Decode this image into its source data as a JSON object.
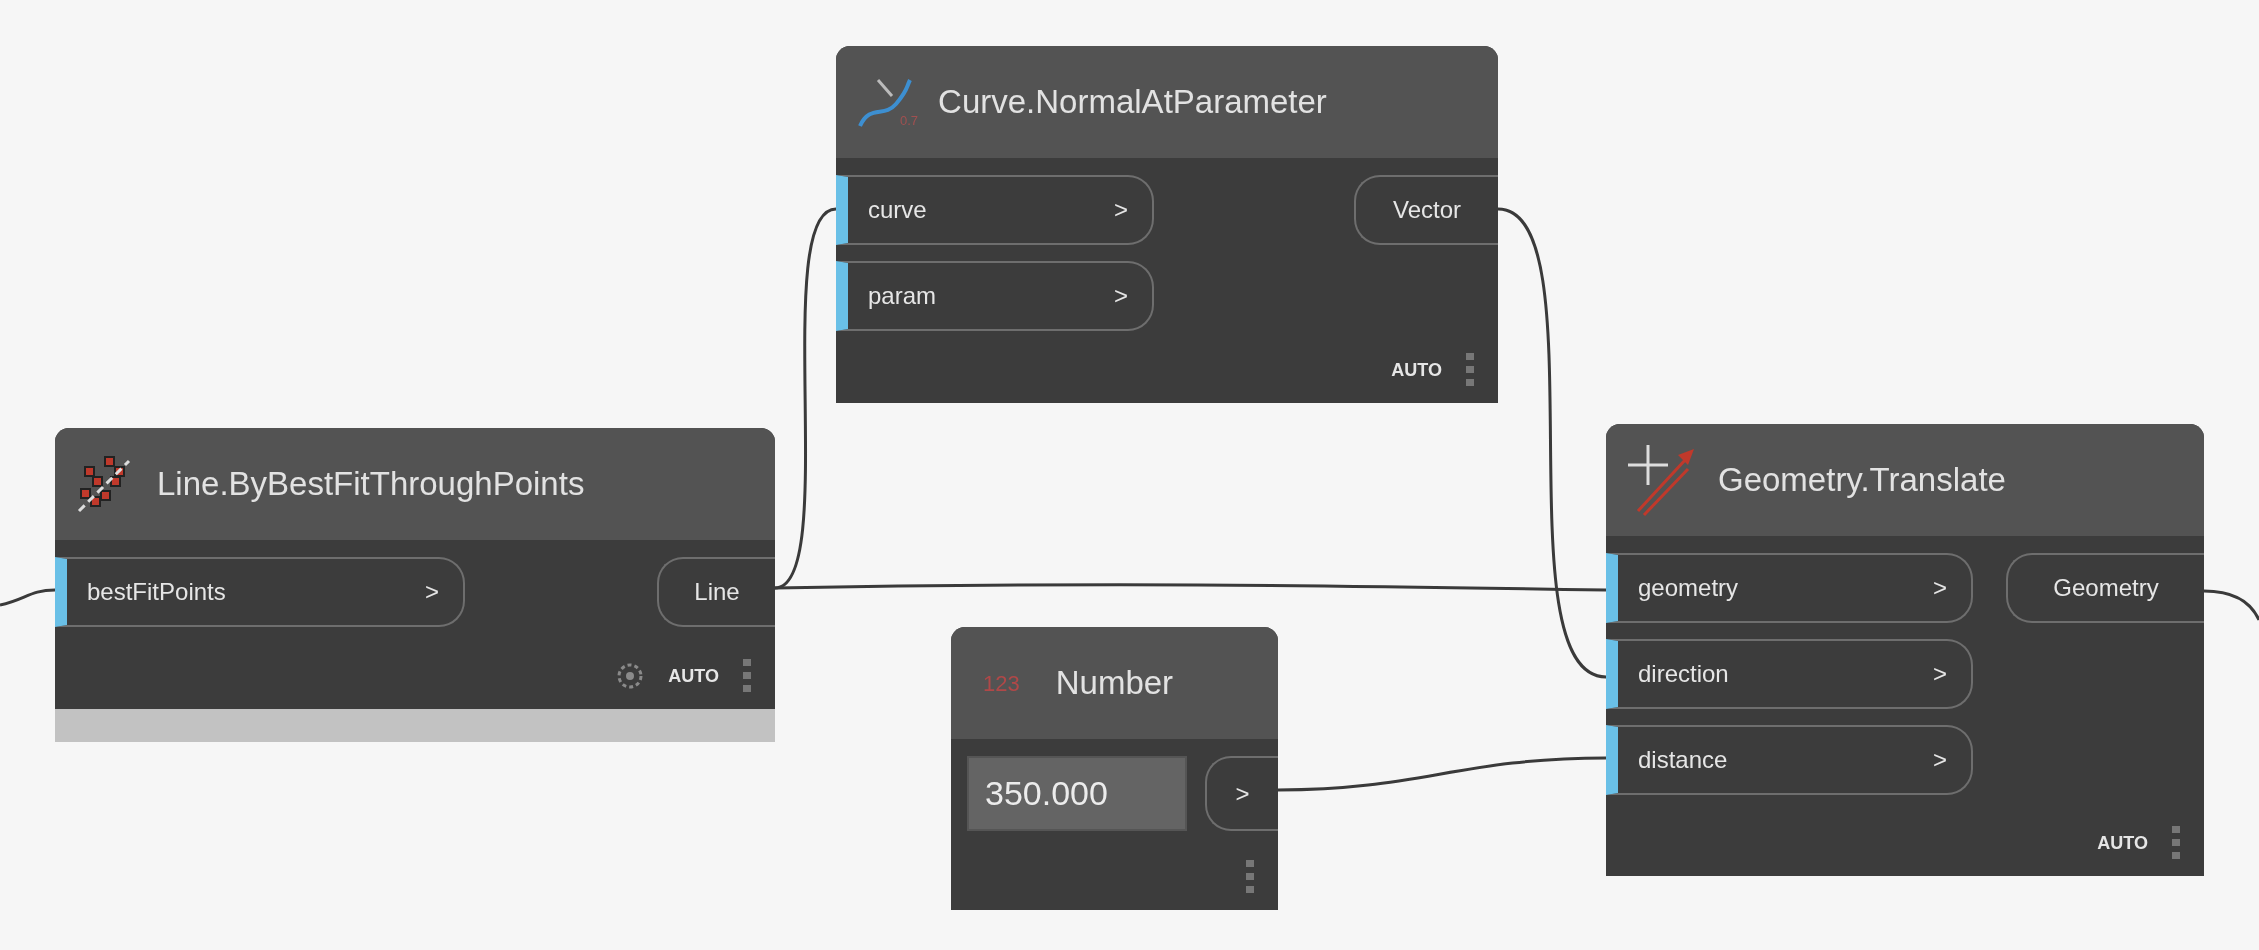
{
  "nodes": [
    {
      "kind": "curve",
      "title": "Curve.NormalAtParameter",
      "icon_label": "0.7",
      "inputs": [
        {
          "label": "curve",
          "arrow": ">"
        },
        {
          "label": "param",
          "arrow": ">"
        }
      ],
      "outputs": [
        {
          "label": "Vector"
        }
      ],
      "lacing": "AUTO",
      "preview_off": false
    },
    {
      "kind": "line",
      "title": "Line.ByBestFitThroughPoints",
      "inputs": [
        {
          "label": "bestFitPoints",
          "arrow": ">"
        }
      ],
      "outputs": [
        {
          "label": "Line"
        }
      ],
      "lacing": "AUTO",
      "preview_off": true
    },
    {
      "kind": "number",
      "title": "Number",
      "icon_label": "123",
      "value": "350.000",
      "outputs": [
        {
          "label": ">"
        }
      ]
    },
    {
      "kind": "translate",
      "title": "Geometry.Translate",
      "inputs": [
        {
          "label": "geometry",
          "arrow": ">"
        },
        {
          "label": "direction",
          "arrow": ">"
        },
        {
          "label": "distance",
          "arrow": ">"
        }
      ],
      "outputs": [
        {
          "label": "Geometry"
        }
      ],
      "lacing": "AUTO",
      "preview_off": false
    }
  ]
}
